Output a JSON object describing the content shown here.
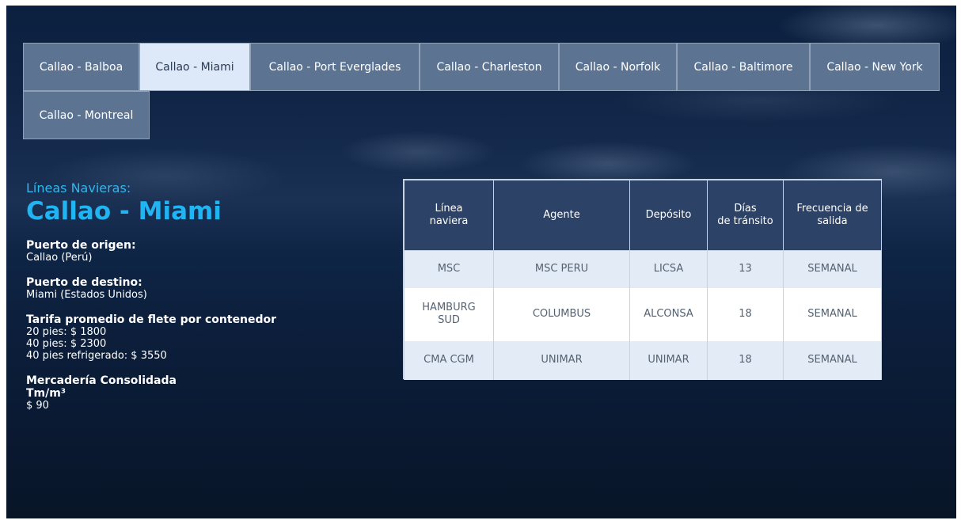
{
  "tabs": [
    {
      "label": "Callao - Balboa",
      "active": false
    },
    {
      "label": "Callao - Miami",
      "active": true
    },
    {
      "label": "Callao - Port Everglades",
      "active": false
    },
    {
      "label": "Callao - Charleston",
      "active": false
    },
    {
      "label": "Callao - Norfolk",
      "active": false
    },
    {
      "label": "Callao - Baltimore",
      "active": false
    },
    {
      "label": "Callao - New York",
      "active": false
    },
    {
      "label": "Callao - Montreal",
      "active": false
    }
  ],
  "info": {
    "kicker": "Líneas Navieras:",
    "title": "Callao - Miami",
    "origin_label": "Puerto de origen:",
    "origin_value": "Callao (Perú)",
    "destination_label": "Puerto de destino:",
    "destination_value": "Miami (Estados Unidos)",
    "tariff_label": "Tarifa promedio de flete por contenedor",
    "tariff_20": "20 pies: $ 1800",
    "tariff_40": "40 pies: $ 2300",
    "tariff_40r": "40 pies refrigerado: $ 3550",
    "consolidated_label": "Mercadería Consolidada",
    "consolidated_unit": "Tm/m³",
    "consolidated_value": "$ 90"
  },
  "table": {
    "headers": {
      "linea_1": "Línea",
      "linea_2": "naviera",
      "agente": "Agente",
      "deposito": "Depósito",
      "dias_1": "Días",
      "dias_2": "de tránsito",
      "frecuencia_1": "Frecuencia de",
      "frecuencia_2": "salida"
    },
    "rows": [
      {
        "linea_1": "MSC",
        "linea_2": "",
        "agente": "MSC PERU",
        "deposito": "LICSA",
        "dias": "13",
        "frecuencia": "SEMANAL"
      },
      {
        "linea_1": "HAMBURG",
        "linea_2": "SUD",
        "agente": "COLUMBUS",
        "deposito": "ALCONSA",
        "dias": "18",
        "frecuencia": "SEMANAL"
      },
      {
        "linea_1": "CMA CGM",
        "linea_2": "",
        "agente": "UNIMAR",
        "deposito": "UNIMAR",
        "dias": "18",
        "frecuencia": "SEMANAL"
      }
    ]
  },
  "colors": {
    "tab_bg": "#5c7491",
    "tab_active_bg": "#dde8f8",
    "title_accent": "#20b4f2",
    "table_header_bg": "#2c4266",
    "row_alt_bg": "#e3ebf7"
  }
}
